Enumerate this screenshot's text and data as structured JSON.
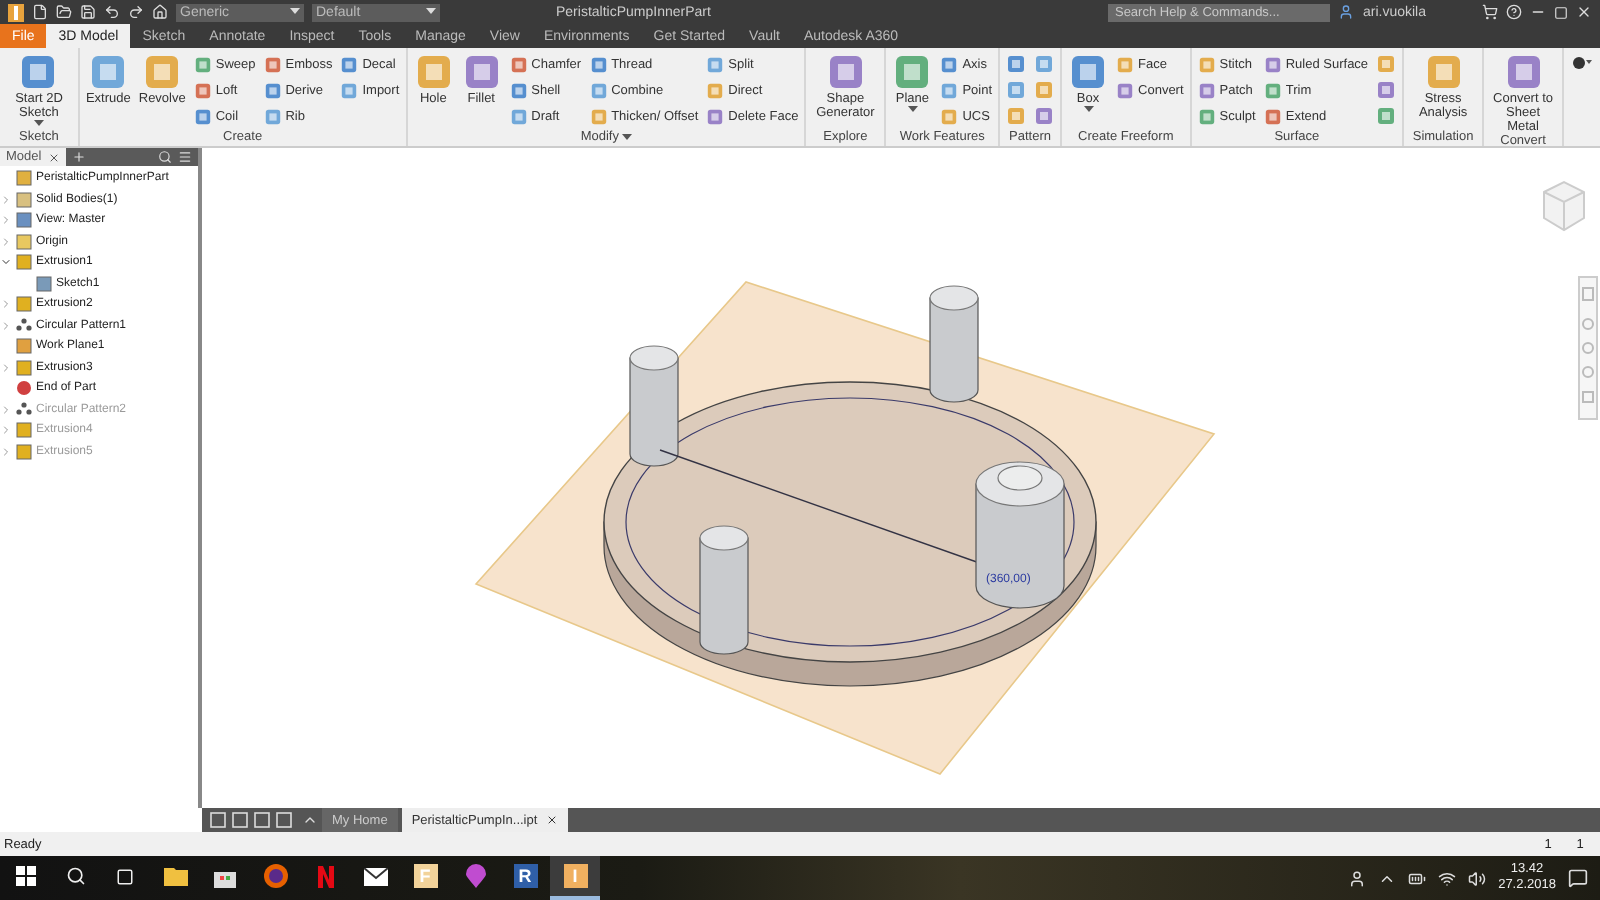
{
  "title_bar": {
    "style_menu": "Generic",
    "appearance_menu": "Default",
    "document_title": "PeristalticPumpInnerPart",
    "search": {
      "placeholder": "Search Help & Commands..."
    },
    "user": "ari.vuokila"
  },
  "ribbon_tabs": [
    {
      "label": "File",
      "kind": "file",
      "selected": false
    },
    {
      "label": "3D Model",
      "kind": "tab",
      "selected": true
    },
    {
      "label": "Sketch",
      "kind": "tab",
      "selected": false
    },
    {
      "label": "Annotate",
      "kind": "tab",
      "selected": false
    },
    {
      "label": "Inspect",
      "kind": "tab",
      "selected": false
    },
    {
      "label": "Tools",
      "kind": "tab",
      "selected": false
    },
    {
      "label": "Manage",
      "kind": "tab",
      "selected": false
    },
    {
      "label": "View",
      "kind": "tab",
      "selected": false
    },
    {
      "label": "Environments",
      "kind": "tab",
      "selected": false
    },
    {
      "label": "Get Started",
      "kind": "tab",
      "selected": false
    },
    {
      "label": "Vault",
      "kind": "tab",
      "selected": false
    },
    {
      "label": "Autodesk A360",
      "kind": "tab",
      "selected": false
    }
  ],
  "ribbon_panels": [
    {
      "label": "Sketch",
      "has_menu": false,
      "columns": [
        {
          "kind": "large",
          "label": "Start 2D Sketch",
          "has_menu": true
        }
      ]
    },
    {
      "label": "Create",
      "has_menu": false,
      "columns": [
        {
          "kind": "large",
          "label": "Extrude",
          "has_menu": false
        },
        {
          "kind": "large",
          "label": "Revolve",
          "has_menu": false
        },
        {
          "kind": "stack",
          "items": [
            "Sweep",
            "Loft",
            "Coil"
          ]
        },
        {
          "kind": "stack",
          "items": [
            "Emboss",
            "Derive",
            "Rib"
          ]
        },
        {
          "kind": "stack",
          "items": [
            "Decal",
            "Import"
          ]
        }
      ]
    },
    {
      "label": "Modify",
      "has_menu": true,
      "columns": [
        {
          "kind": "large",
          "label": "Hole",
          "has_menu": false
        },
        {
          "kind": "large",
          "label": "Fillet",
          "has_menu": false
        },
        {
          "kind": "stack",
          "items": [
            "Chamfer",
            "Shell",
            "Draft"
          ]
        },
        {
          "kind": "stack",
          "items": [
            "Thread",
            "Combine",
            "Thicken/ Offset"
          ]
        },
        {
          "kind": "stack",
          "items": [
            "Split",
            "Direct",
            "Delete Face"
          ]
        }
      ]
    },
    {
      "label": "Explore",
      "has_menu": false,
      "columns": [
        {
          "kind": "large",
          "label": "Shape Generator",
          "has_menu": false
        }
      ]
    },
    {
      "label": "Work Features",
      "has_menu": false,
      "columns": [
        {
          "kind": "large",
          "label": "Plane",
          "has_menu": true
        },
        {
          "kind": "stack",
          "items": [
            "Axis",
            "Point",
            "UCS"
          ]
        }
      ]
    },
    {
      "label": "Pattern",
      "has_menu": false,
      "columns": [
        {
          "kind": "icons"
        },
        {
          "kind": "icons"
        }
      ]
    },
    {
      "label": "Create Freeform",
      "has_menu": false,
      "columns": [
        {
          "kind": "large",
          "label": "Box",
          "has_menu": true
        },
        {
          "kind": "stack",
          "items": [
            "Face",
            "Convert"
          ]
        }
      ]
    },
    {
      "label": "Surface",
      "has_menu": false,
      "columns": [
        {
          "kind": "stack",
          "items": [
            "Stitch",
            "Patch",
            "Sculpt"
          ]
        },
        {
          "kind": "stack",
          "items": [
            "Ruled Surface",
            "Trim",
            "Extend"
          ]
        },
        {
          "kind": "icons"
        }
      ]
    },
    {
      "label": "Simulation",
      "has_menu": false,
      "columns": [
        {
          "kind": "large",
          "label": "Stress Analysis",
          "has_menu": false
        }
      ]
    },
    {
      "label": "Convert",
      "has_menu": false,
      "columns": [
        {
          "kind": "large",
          "label": "Convert to Sheet Metal",
          "has_menu": false
        }
      ]
    }
  ],
  "browser": {
    "tab": "Model",
    "tree": [
      {
        "label": "PeristalticPumpInnerPart",
        "kind": "part",
        "expandable": false,
        "disabled": false,
        "children": [
          {
            "label": "Solid Bodies(1)",
            "kind": "bodies",
            "expandable": true,
            "expanded": false,
            "disabled": false
          },
          {
            "label": "View: Master",
            "kind": "view",
            "expandable": true,
            "expanded": false,
            "disabled": false
          },
          {
            "label": "Origin",
            "kind": "folder",
            "expandable": true,
            "expanded": false,
            "disabled": false
          },
          {
            "label": "Extrusion1",
            "kind": "feature",
            "expandable": true,
            "expanded": true,
            "disabled": false,
            "children": [
              {
                "label": "Sketch1",
                "kind": "sketch",
                "expandable": false,
                "disabled": false
              }
            ]
          },
          {
            "label": "Extrusion2",
            "kind": "feature",
            "expandable": true,
            "expanded": false,
            "disabled": false
          },
          {
            "label": "Circular Pattern1",
            "kind": "pattern",
            "expandable": true,
            "expanded": false,
            "disabled": false
          },
          {
            "label": "Work Plane1",
            "kind": "plane",
            "expandable": false,
            "disabled": false
          },
          {
            "label": "Extrusion3",
            "kind": "feature",
            "expandable": true,
            "expanded": false,
            "disabled": false
          },
          {
            "label": "End of Part",
            "kind": "end",
            "expandable": false,
            "disabled": false
          },
          {
            "label": "Circular Pattern2",
            "kind": "pattern",
            "expandable": true,
            "expanded": false,
            "disabled": true
          },
          {
            "label": "Extrusion4",
            "kind": "feature",
            "expandable": true,
            "expanded": false,
            "disabled": true
          },
          {
            "label": "Extrusion5",
            "kind": "feature",
            "expandable": true,
            "expanded": false,
            "disabled": true
          }
        ]
      }
    ]
  },
  "viewport": {
    "dimension": "(360,00)"
  },
  "document_tabs": [
    {
      "label": "My Home",
      "selected": false
    },
    {
      "label": "PeristalticPumpIn...ipt",
      "selected": true
    }
  ],
  "status_bar": {
    "message": "Ready",
    "count_1": "1",
    "count_2": "1"
  },
  "taskbar": {
    "apps": [
      {
        "kind": "explorer",
        "selected": false
      },
      {
        "kind": "store",
        "selected": false
      },
      {
        "kind": "firefox",
        "selected": false
      },
      {
        "kind": "netflix",
        "selected": false
      },
      {
        "kind": "mail",
        "selected": false
      },
      {
        "kind": "letter",
        "glyph": "F",
        "color": "#f2d39a",
        "selected": false
      },
      {
        "kind": "maps",
        "selected": false
      },
      {
        "kind": "letter",
        "glyph": "R",
        "color": "#2f5fa8",
        "selected": false
      },
      {
        "kind": "letter",
        "glyph": "I",
        "color": "#f0b060",
        "selected": true
      }
    ],
    "time": "13.42",
    "date": "27.2.2018"
  }
}
